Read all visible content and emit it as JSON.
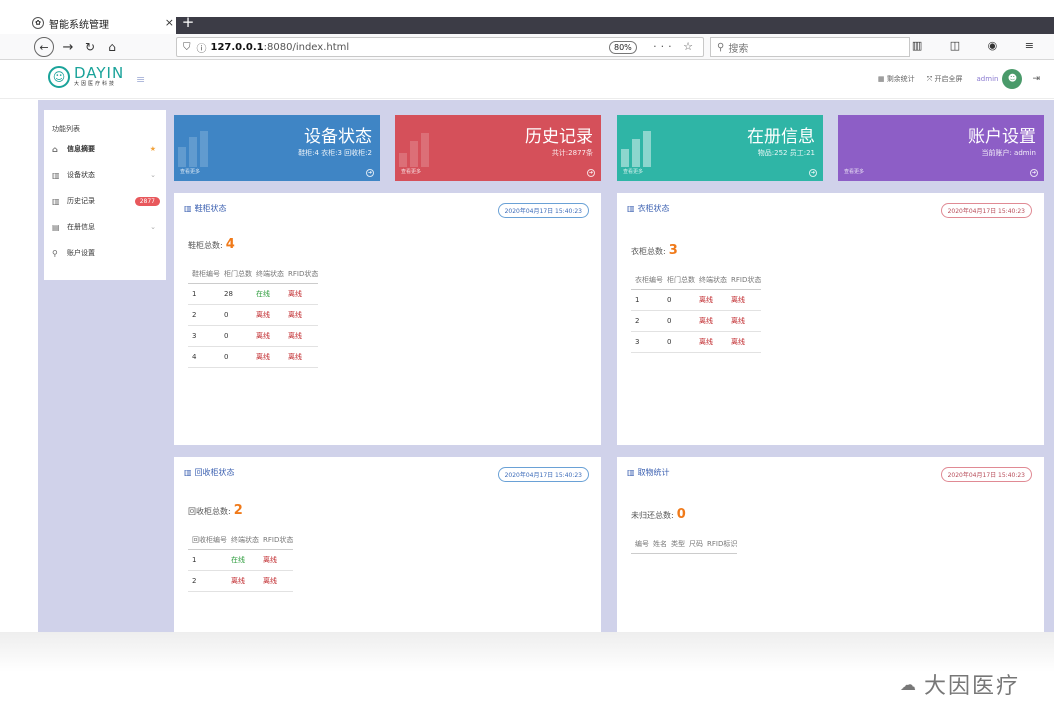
{
  "browser": {
    "tab_title": "智能系统管理",
    "tab_close": "×",
    "new_tab": "+",
    "url_host": "127.0.0.1",
    "url_rest": ":8080/index.html",
    "zoom": "80%",
    "url_actions": "··· ☆",
    "search_placeholder": "搜索",
    "tool_icons": "▥ ◫ ◉ ≡"
  },
  "app": {
    "logo_text": "DAYIN",
    "logo_sub": "大因医疗科技",
    "menu_toggle": "≡",
    "header": {
      "stats_label": "剩余统计",
      "fullscreen_label": "开启全屏",
      "user": "admin",
      "logout": "⇥"
    },
    "sidebar": {
      "title": "功能列表",
      "items": [
        {
          "icon": "⌂",
          "label": "信息摘要",
          "right": "★"
        },
        {
          "icon": "▥",
          "label": "设备状态",
          "right": "⌄"
        },
        {
          "icon": "▥",
          "label": "历史记录",
          "badge": "2877"
        },
        {
          "icon": "▤",
          "label": "在册信息",
          "right": "⌄"
        },
        {
          "icon": "⚲",
          "label": "账户设置"
        }
      ]
    },
    "cards": [
      {
        "title": "设备状态",
        "sub": "鞋柜:4 衣柜:3 回收柜:2",
        "more": "查看更多",
        "color": "#3f85c5"
      },
      {
        "title": "历史记录",
        "sub": "共计:2877条",
        "more": "查看更多",
        "color": "#d5505a"
      },
      {
        "title": "在册信息",
        "sub": "物品:252 员工:21",
        "more": "查看更多",
        "color": "#2fb5a6"
      },
      {
        "title": "账户设置",
        "sub": "当前账户: admin",
        "more": "查看更多",
        "color": "#8d5ec6"
      }
    ],
    "shoe_panel": {
      "title": "鞋柜状态",
      "date": "2020年04月17日 15:40:23",
      "count_label": "鞋柜总数:",
      "count": "4",
      "headers": [
        "鞋柜编号",
        "柜门总数",
        "终端状态",
        "RFID状态"
      ],
      "rows": [
        [
          "1",
          "28",
          "在线",
          "离线"
        ],
        [
          "2",
          "0",
          "离线",
          "离线"
        ],
        [
          "3",
          "0",
          "离线",
          "离线"
        ],
        [
          "4",
          "0",
          "离线",
          "离线"
        ]
      ]
    },
    "cloth_panel": {
      "title": "衣柜状态",
      "date": "2020年04月17日 15:40:23",
      "count_label": "衣柜总数:",
      "count": "3",
      "headers": [
        "衣柜编号",
        "柜门总数",
        "终端状态",
        "RFID状态"
      ],
      "rows": [
        [
          "1",
          "0",
          "离线",
          "离线"
        ],
        [
          "2",
          "0",
          "离线",
          "离线"
        ],
        [
          "3",
          "0",
          "离线",
          "离线"
        ]
      ]
    },
    "recycle_panel": {
      "title": "回收柜状态",
      "date": "2020年04月17日 15:40:23",
      "count_label": "回收柜总数:",
      "count": "2",
      "headers": [
        "回收柜编号",
        "终端状态",
        "RFID状态"
      ],
      "rows": [
        [
          "1",
          "在线",
          "离线"
        ],
        [
          "2",
          "离线",
          "离线"
        ]
      ]
    },
    "pickup_panel": {
      "title": "取物统计",
      "date": "2020年04月17日 15:40:23",
      "count_label": "未归还总数:",
      "count": "0",
      "headers": [
        "编号",
        "姓名",
        "类型",
        "尺码",
        "RFID标识"
      ]
    }
  },
  "watermark": "大因医疗"
}
